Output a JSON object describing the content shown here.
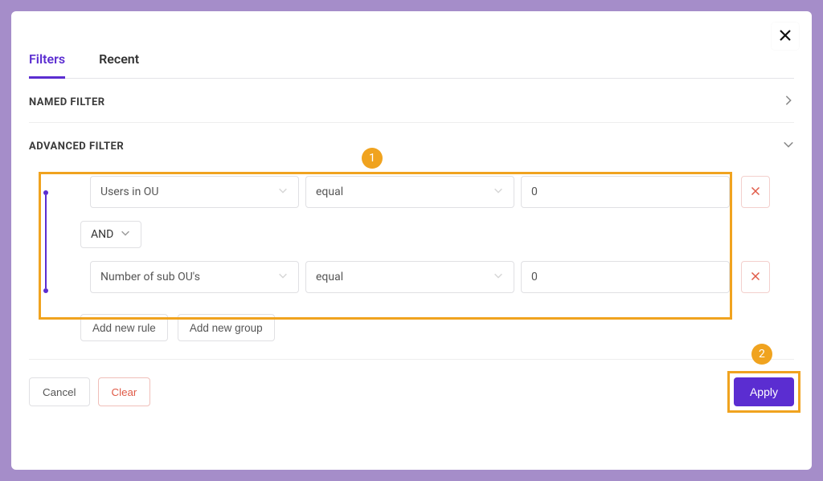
{
  "tabs": {
    "filters": "Filters",
    "recent": "Recent"
  },
  "sections": {
    "named": {
      "title": "NAMED FILTER"
    },
    "advanced": {
      "title": "ADVANCED FILTER"
    }
  },
  "rules": [
    {
      "field": "Users in OU",
      "op": "equal",
      "value": "0"
    },
    {
      "field": "Number of sub OU's",
      "op": "equal",
      "value": "0"
    }
  ],
  "logic_op": "AND",
  "buttons": {
    "add_rule": "Add new rule",
    "add_group": "Add new group",
    "cancel": "Cancel",
    "clear": "Clear",
    "apply": "Apply"
  },
  "annotations": {
    "step1": "1",
    "step2": "2"
  }
}
